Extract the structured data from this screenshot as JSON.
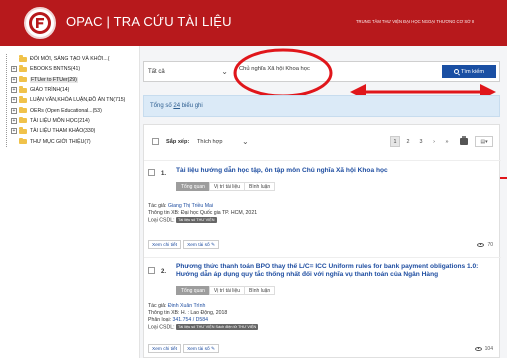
{
  "header": {
    "title": "OPAC | TRA CỨU TÀI LIỆU",
    "org": "TRUNG TÂM THƯ VIỆN ĐẠI HỌC NGOẠI THƯƠNG CƠ SỞ II"
  },
  "sidebar": {
    "items": [
      {
        "label": "ĐỔI MỚI, SÁNG TẠO VÀ KHỞI...(",
        "expander": ""
      },
      {
        "label": "EBOOKS BNTNS(41)",
        "expander": "+"
      },
      {
        "label": "FTUer to FTUer(29)",
        "expander": "+",
        "active": true
      },
      {
        "label": "GIÁO TRÌNH(14)",
        "expander": "+"
      },
      {
        "label": "LUẬN VĂN,KHÓA LUẬN,ĐỒ ÁN TN(715)",
        "expander": "+"
      },
      {
        "label": "OERs (Open Educational...(53)",
        "expander": "+"
      },
      {
        "label": "TÀI LIỆU MÔN HỌC(214)",
        "expander": "+"
      },
      {
        "label": "TÀI LIỆU THAM KHẢO(330)",
        "expander": "+"
      },
      {
        "label": "THƯ MỤC GIỚI THIỆU(7)",
        "expander": ""
      }
    ]
  },
  "search": {
    "field": "Tất cả",
    "query": "Chủ nghĩa Xã hội Khoa học",
    "button": "Tìm kiếm"
  },
  "summary": {
    "prefix": "Tổng số ",
    "count": "24",
    "suffix": " biểu ghi"
  },
  "toolbar": {
    "sort_label": "Sắp xếp:",
    "sort_value": "Thích hợp",
    "pages": [
      "1",
      "2",
      "3",
      "›",
      "»"
    ],
    "export": "▤▾"
  },
  "results": [
    {
      "num": "1.",
      "title": "Tài liệu hướng dẫn học tập, ôn tập môn Chủ nghĩa Xã hội Khoa học",
      "tabs": [
        "Tổng quan",
        "Vị trí tài liệu",
        "Bình luận"
      ],
      "author_label": "Tác giả: ",
      "author": "Giang Thị Triều Mai",
      "publish": "Thông tin XB: Đại học Quốc gia TP. HCM, 2021",
      "type_label": "Loại CSDL: ",
      "type_badge": "Tài liệu số THƯ VIỆN",
      "class_label": "",
      "class_value": "",
      "buttons": [
        "Xem chi tiết",
        "Xem tài số ✎"
      ],
      "views": "70"
    },
    {
      "num": "2.",
      "title": "Phương thức thanh toán BPO thay thế L/C= ICC Uniform rules for bank payment obligations 1.0: Hướng dẫn áp dụng quy tắc thống nhất đối với nghĩa vụ thanh toán của Ngân Hàng",
      "tabs": [
        "Tổng quan",
        "Vị trí tài liệu",
        "Bình luận"
      ],
      "author_label": "Tác giả: ",
      "author": "Đinh Xuân Trình",
      "publish": "Thông tin XB: H. : Lao Động, 2018",
      "class_label": "Phân loại: ",
      "class_value": "341.754 / D584",
      "type_label": "Loại CSDL: ",
      "type_badge": "Tài liệu số THƯ VIỆN Sách điện tử THƯ VIỆN",
      "buttons": [
        "Xem chi tiết",
        "Xem tài số ✎"
      ],
      "views": "104"
    }
  ],
  "colors": {
    "header": "#b7191c",
    "accent": "#1a4fa3",
    "annotation": "#e0161b"
  }
}
